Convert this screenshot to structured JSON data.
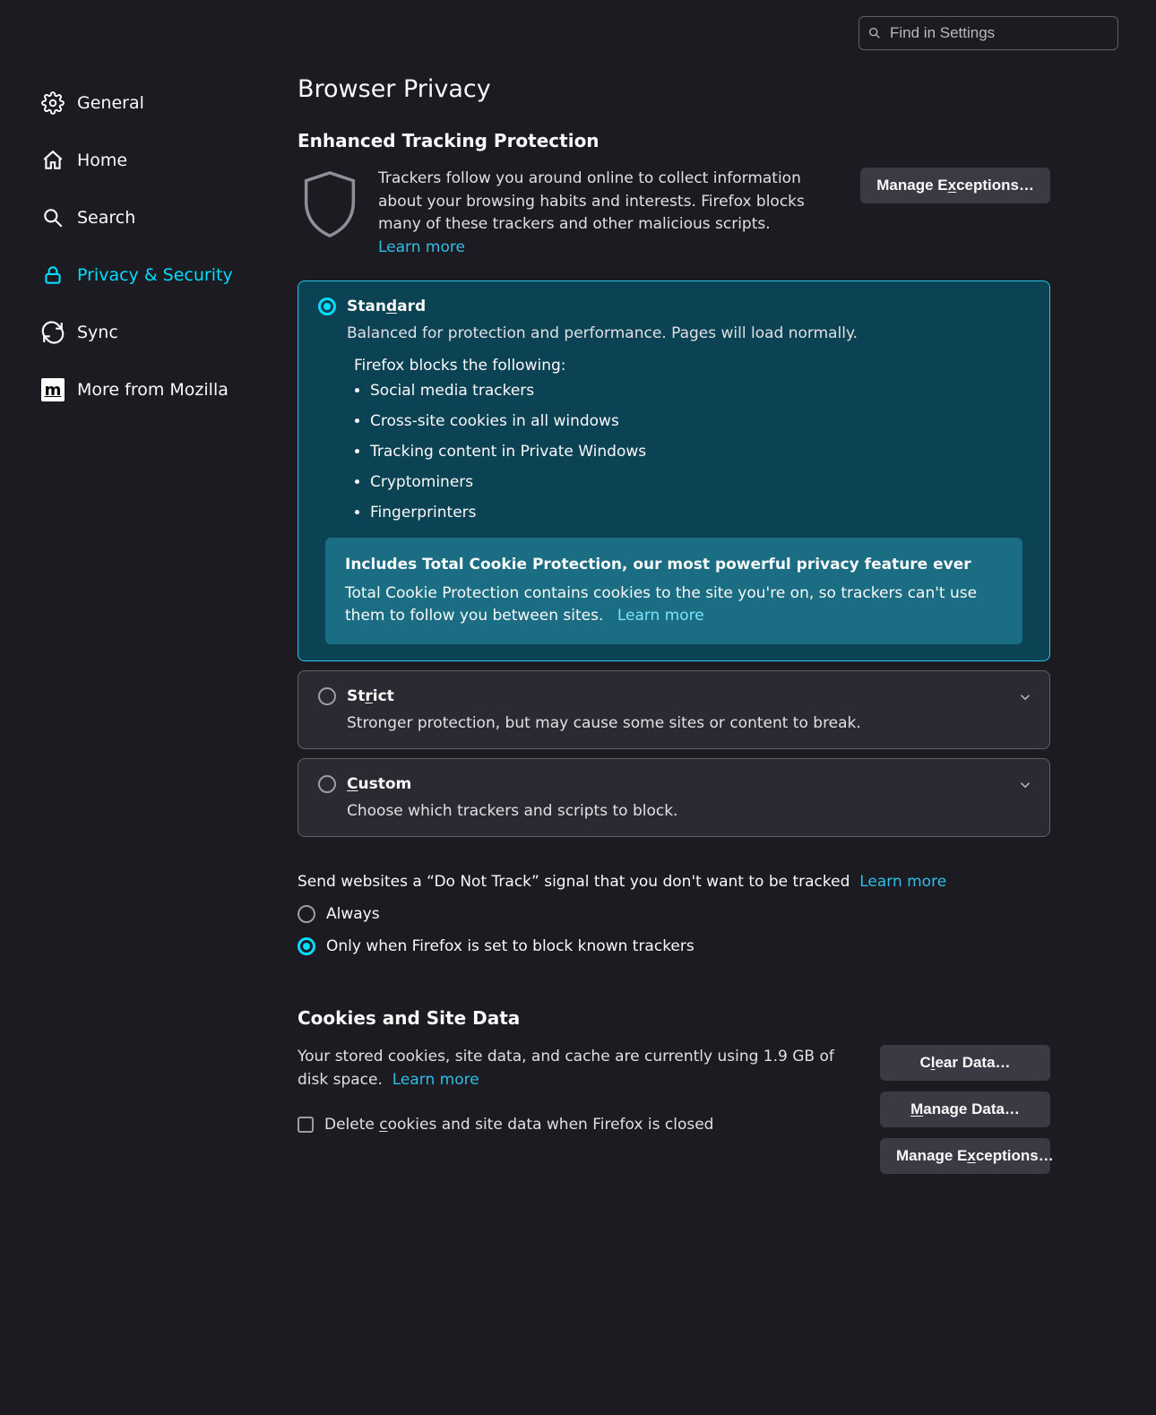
{
  "search": {
    "placeholder": "Find in Settings"
  },
  "sidebar": {
    "items": [
      {
        "label": "General"
      },
      {
        "label": "Home"
      },
      {
        "label": "Search"
      },
      {
        "label": "Privacy & Security"
      },
      {
        "label": "Sync"
      },
      {
        "label": "More from Mozilla"
      }
    ]
  },
  "page": {
    "title": "Browser Privacy"
  },
  "etp": {
    "title": "Enhanced Tracking Protection",
    "desc": "Trackers follow you around online to collect information about your browsing habits and interests. Firefox blocks many of these trackers and other malicious scripts.",
    "learn_more": "Learn more",
    "manage_exceptions_pre": "Manage E",
    "manage_exceptions_u": "x",
    "manage_exceptions_post": "ceptions…",
    "standard": {
      "title_pre": "Stan",
      "title_u": "d",
      "title_post": "ard",
      "desc": "Balanced for protection and performance. Pages will load normally.",
      "blocks_label": "Firefox blocks the following:",
      "blocks": [
        "Social media trackers",
        "Cross-site cookies in all windows",
        "Tracking content in Private Windows",
        "Cryptominers",
        "Fingerprinters"
      ],
      "tcp_title": "Includes Total Cookie Protection, our most powerful privacy feature ever",
      "tcp_desc": "Total Cookie Protection contains cookies to the site you're on, so trackers can't use them to follow you between sites.",
      "tcp_learn_more": "Learn more"
    },
    "strict": {
      "title_pre": "St",
      "title_u": "r",
      "title_post": "ict",
      "desc": "Stronger protection, but may cause some sites or content to break."
    },
    "custom": {
      "title_pre": "",
      "title_u": "C",
      "title_post": "ustom",
      "desc": "Choose which trackers and scripts to block."
    }
  },
  "dnt": {
    "text": "Send websites a “Do Not Track” signal that you don't want to be tracked",
    "learn_more": "Learn more",
    "always": "Always",
    "only_when": "Only when Firefox is set to block known trackers"
  },
  "cookies": {
    "title": "Cookies and Site Data",
    "desc": "Your stored cookies, site data, and cache are currently using 1.9 GB of disk space.",
    "learn_more": "Learn more",
    "clear_pre": "C",
    "clear_u": "l",
    "clear_post": "ear Data…",
    "manage_pre": "",
    "manage_u": "M",
    "manage_post": "anage Data…",
    "exc_pre": "Manage E",
    "exc_u": "x",
    "exc_post": "ceptions…",
    "delete_pre": "Delete ",
    "delete_u": "c",
    "delete_post": "ookies and site data when Firefox is closed"
  }
}
